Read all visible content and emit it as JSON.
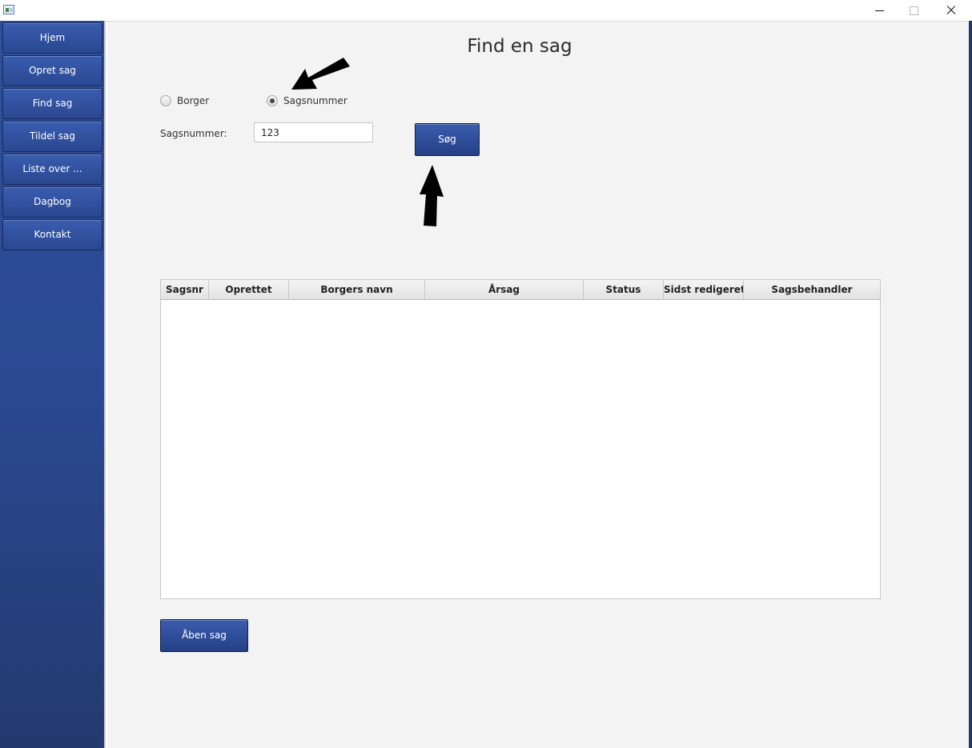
{
  "window": {
    "controls": [
      "minimize-icon",
      "maximize-icon",
      "close-icon"
    ]
  },
  "sidebar": {
    "items": [
      {
        "label": "Hjem"
      },
      {
        "label": "Opret sag"
      },
      {
        "label": "Find sag"
      },
      {
        "label": "Tildel sag"
      },
      {
        "label": "Liste over ..."
      },
      {
        "label": "Dagbog"
      },
      {
        "label": "Kontakt"
      }
    ]
  },
  "main": {
    "title": "Find en sag",
    "search_mode": {
      "options": [
        {
          "label": "Borger",
          "checked": false
        },
        {
          "label": "Sagsnummer",
          "checked": true
        }
      ]
    },
    "field_label": "Sagsnummer:",
    "field_value": "123",
    "search_button": "Søg",
    "table": {
      "columns": [
        "Sagsnr",
        "Oprettet",
        "Borgers navn",
        "Årsag",
        "Status",
        "Sidst redigeret",
        "Sagsbehandler"
      ],
      "rows": []
    },
    "open_button": "Åben sag"
  },
  "colors": {
    "accent": "#2b4a95",
    "button_border": "#101e46",
    "background": "#f3f3f3"
  }
}
